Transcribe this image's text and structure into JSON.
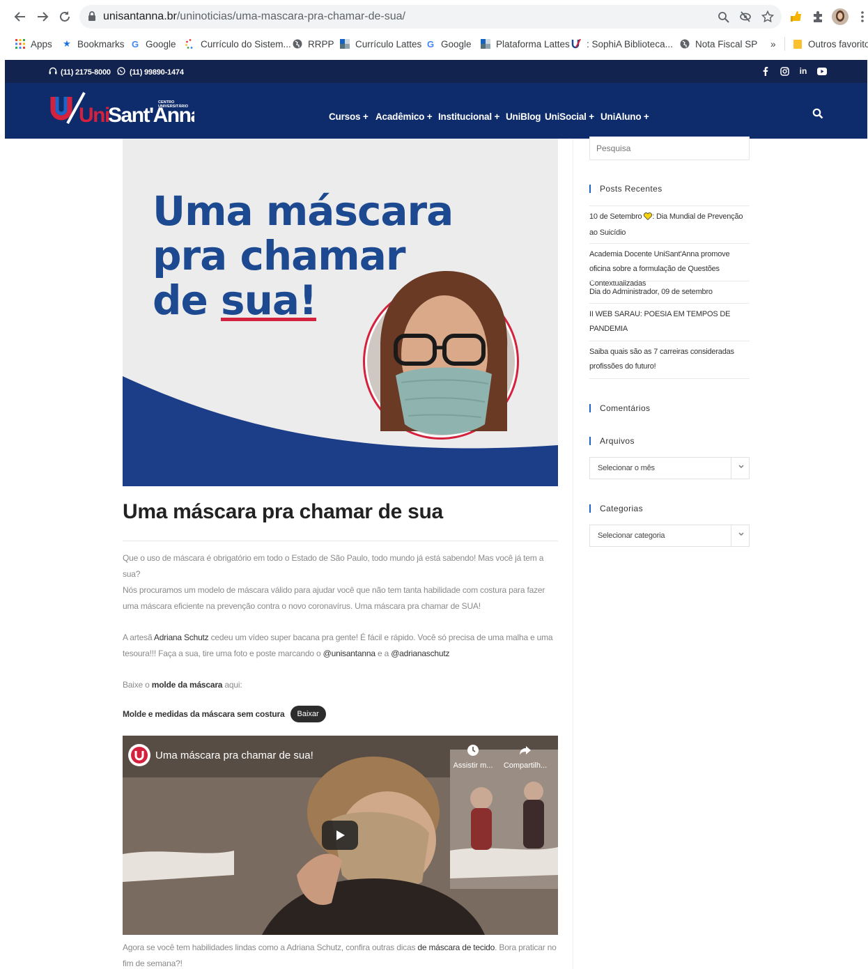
{
  "browser": {
    "url_host": "unisantanna.br",
    "url_path": "/uninoticias/uma-mascara-pra-chamar-de-sua/",
    "bookmarks": [
      {
        "label": "Apps",
        "icon": "apps-grid-icon"
      },
      {
        "label": "Bookmarks",
        "icon": "star-icon"
      },
      {
        "label": "Google",
        "icon": "google-icon"
      },
      {
        "label": "Currículo do Sistem...",
        "icon": "cnpq-icon"
      },
      {
        "label": "RRPP",
        "icon": "globe-icon"
      },
      {
        "label": "Currículo Lattes",
        "icon": "lattes-icon"
      },
      {
        "label": "Google",
        "icon": "google-icon"
      },
      {
        "label": "Plataforma Lattes",
        "icon": "lattes-icon"
      },
      {
        "label": ": SophiA Biblioteca...",
        "icon": "unisantanna-icon"
      },
      {
        "label": "Nota Fiscal SP",
        "icon": "globe-icon"
      }
    ],
    "overflow_label": "»",
    "other_bookmarks": "Outros favoritos"
  },
  "site": {
    "phone": "(11) 2175-8000",
    "whatsapp": "(11) 99890-1474",
    "logo_text_uni": "Uni",
    "logo_text_santanna": "Sant'Anna",
    "logo_tag_line1": "CENTRO",
    "logo_tag_line2": "UNIVERSITÁRIO",
    "nav": [
      "Cursos +",
      "Acadêmico +",
      "Institucional +",
      "UniBlog",
      "UniSocial +",
      "UniAluno +"
    ],
    "social_labels": {
      "linkedin": "in"
    }
  },
  "post": {
    "hero_lines": [
      "Uma máscara",
      "pra chamar",
      "de "
    ],
    "hero_emph": "sua!",
    "title": "Uma máscara pra chamar de sua",
    "p1": "Que o uso de máscara é obrigatório em todo o Estado de São Paulo, todo mundo já está sabendo! Mas você já tem a sua?",
    "p2": "Nós procuramos um modelo de máscara válido para ajudar você que não tem tanta habilidade com costura para fazer uma máscara eficiente na prevenção contra o novo coronavírus. Uma máscara pra chamar de SUA!",
    "p3_a": "A artesã ",
    "p3_name": "Adriana Schutz",
    "p3_b": " cedeu um vídeo super bacana pra gente! É fácil e rápido. Você só precisa de uma malha e uma tesoura!!! Faça a sua, tire uma foto e poste marcando o ",
    "p3_tag1": "@unisantanna",
    "p3_c": " e a ",
    "p3_tag2": "@adrianaschutz",
    "p4_a": "Baixe o ",
    "p4_b": "molde da máscara",
    "p4_c": " aqui:",
    "download_label": "Molde e medidas da máscara sem costura",
    "download_button": "Baixar",
    "video_title": "Uma máscara pra chamar de sua!",
    "video_watch_later": "Assistir m...",
    "video_share": "Compartilh...",
    "p5_a": "Agora se você tem habilidades lindas como a Adriana Schutz, confira outras dicas ",
    "p5_b": "de máscara de tecido",
    "p5_c": ". Bora praticar no fim de semana?!"
  },
  "sidebar": {
    "search_placeholder": "Pesquisa",
    "recent_title": "Posts Recentes",
    "recent_posts": [
      {
        "a": "10 de Setembro ",
        "b": ": Dia Mundial de Prevenção ao Suicídio"
      },
      {
        "a": "Academia Docente UniSant'Anna promove oficina sobre a formulação de Questões Contextualizadas",
        "b": ""
      },
      {
        "a": "Dia do Administrador, 09 de setembro",
        "b": ""
      },
      {
        "a": "II WEB SARAU: POESIA EM TEMPOS DE PANDEMIA",
        "b": ""
      },
      {
        "a": "Saiba quais são as 7 carreiras consideradas profissões do futuro!",
        "b": ""
      }
    ],
    "comments_title": "Comentários",
    "archives_title": "Arquivos",
    "archives_select": "Selecionar o mês",
    "categories_title": "Categorias",
    "categories_select": "Selecionar categoria"
  },
  "colors": {
    "topbar": "#13234f",
    "navbar": "#0e2b6b",
    "brand_blue": "#1d4991",
    "brand_red": "#d4213d",
    "hero_bg": "#edecec"
  }
}
